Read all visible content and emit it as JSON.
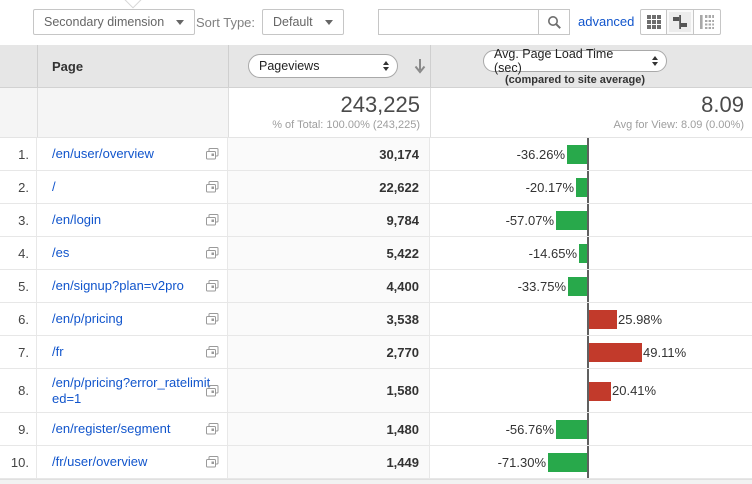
{
  "toolbar": {
    "secondary_dimension": "Secondary dimension",
    "sort_type_label": "Sort Type:",
    "sort_type_value": "Default",
    "search_placeholder": "",
    "advanced_link": "advanced",
    "view_buttons": [
      "table-view",
      "comparison-view",
      "pivot-view"
    ],
    "selected_view": "comparison-view"
  },
  "header": {
    "page_col": "Page",
    "metric_select": "Pageviews",
    "comparison_select": "Avg. Page Load Time (sec)",
    "comparison_note": "(compared to site average)"
  },
  "summary": {
    "pageviews_total": "243,225",
    "pageviews_note": "% of Total: 100.00% (243,225)",
    "avg_value": "8.09",
    "avg_note": "Avg for View: 8.09 (0.00%)"
  },
  "rows": [
    {
      "rank": "1.",
      "page": "/en/user/overview",
      "pageviews": "30,174",
      "delta": "-36.26%",
      "delta_value": -36.26
    },
    {
      "rank": "2.",
      "page": "/",
      "pageviews": "22,622",
      "delta": "-20.17%",
      "delta_value": -20.17
    },
    {
      "rank": "3.",
      "page": "/en/login",
      "pageviews": "9,784",
      "delta": "-57.07%",
      "delta_value": -57.07
    },
    {
      "rank": "4.",
      "page": "/es",
      "pageviews": "5,422",
      "delta": "-14.65%",
      "delta_value": -14.65
    },
    {
      "rank": "5.",
      "page": "/en/signup?plan=v2pro",
      "pageviews": "4,400",
      "delta": "-33.75%",
      "delta_value": -33.75
    },
    {
      "rank": "6.",
      "page": "/en/p/pricing",
      "pageviews": "3,538",
      "delta": "25.98%",
      "delta_value": 25.98
    },
    {
      "rank": "7.",
      "page": "/fr",
      "pageviews": "2,770",
      "delta": "49.11%",
      "delta_value": 49.11
    },
    {
      "rank": "8.",
      "page": "/en/p/pricing?error_ratelimited=1",
      "pageviews": "1,580",
      "delta": "20.41%",
      "delta_value": 20.41
    },
    {
      "rank": "9.",
      "page": "/en/register/segment",
      "pageviews": "1,480",
      "delta": "-56.76%",
      "delta_value": -56.76
    },
    {
      "rank": "10.",
      "page": "/fr/user/overview",
      "pageviews": "1,449",
      "delta": "-71.30%",
      "delta_value": -71.3
    }
  ],
  "colors": {
    "negative_bar": "#28a94b",
    "positive_bar": "#c23a2b",
    "link": "#1155cc",
    "axis": "#606060"
  }
}
